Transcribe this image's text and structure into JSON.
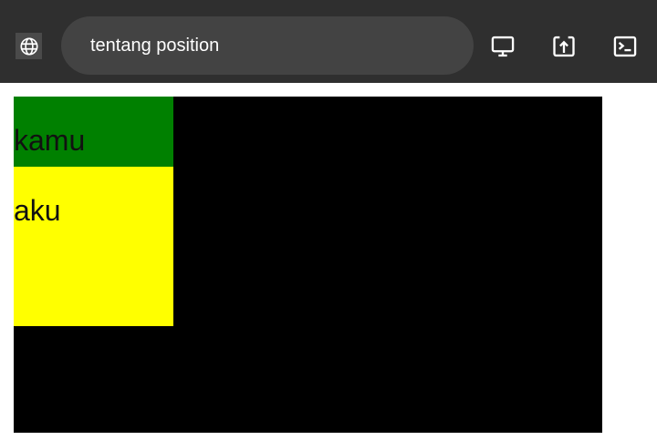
{
  "toolbar": {
    "address_text": "tentang position",
    "icons": {
      "globe": "globe-icon",
      "desktop": "desktop-icon",
      "open_in_new": "open-in-new-icon",
      "terminal": "terminal-icon"
    },
    "colors": {
      "background": "#2f2f2f",
      "address_bar": "#434343",
      "icon": "#ffffff"
    }
  },
  "content": {
    "boxes": [
      {
        "text": "kamu",
        "color": "#008000"
      },
      {
        "text": "aku",
        "color": "#ffff00"
      }
    ],
    "container_color": "#000000"
  }
}
